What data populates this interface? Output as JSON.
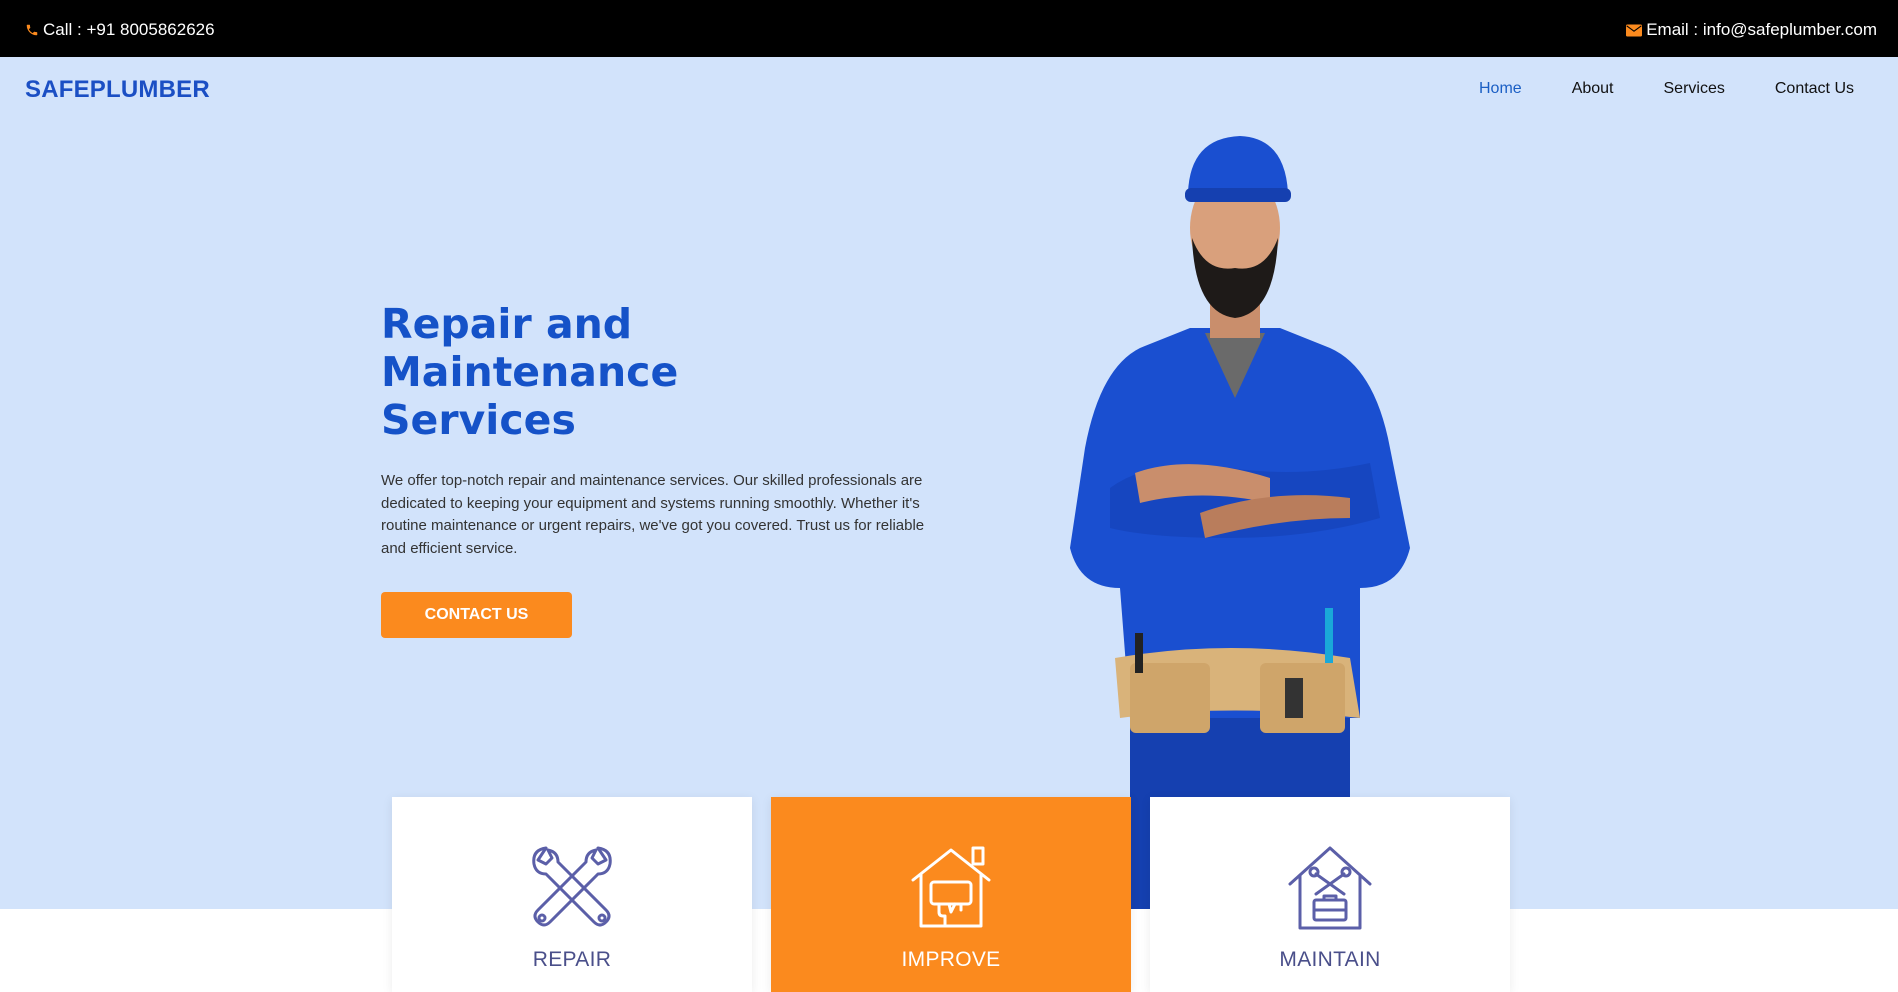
{
  "topbar": {
    "call": "Call : +91 8005862626",
    "email": "Email : info@safeplumber.com"
  },
  "header": {
    "brand": "SAFEPLUMBER",
    "nav": [
      "Home",
      "About",
      "Services",
      "Contact Us"
    ]
  },
  "hero": {
    "title": "Repair and Maintenance Services",
    "description": "We offer top-notch repair and maintenance services. Our skilled professionals are dedicated to keeping your equipment and systems running smoothly. Whether it's routine maintenance or urgent repairs, we've got you covered. Trust us for reliable and efficient service.",
    "cta": "CONTACT US"
  },
  "services": [
    {
      "label": "REPAIR",
      "icon": "wrench-cross-icon"
    },
    {
      "label": "IMPROVE",
      "icon": "house-paint-icon"
    },
    {
      "label": "MAINTAIN",
      "icon": "house-tools-icon"
    }
  ],
  "colors": {
    "topbar": "#000000",
    "hero_bg": "#d2e3fb",
    "brand": "#1b4fc4",
    "accent": "#fb8a1e",
    "icon": "#5b5fa8"
  }
}
